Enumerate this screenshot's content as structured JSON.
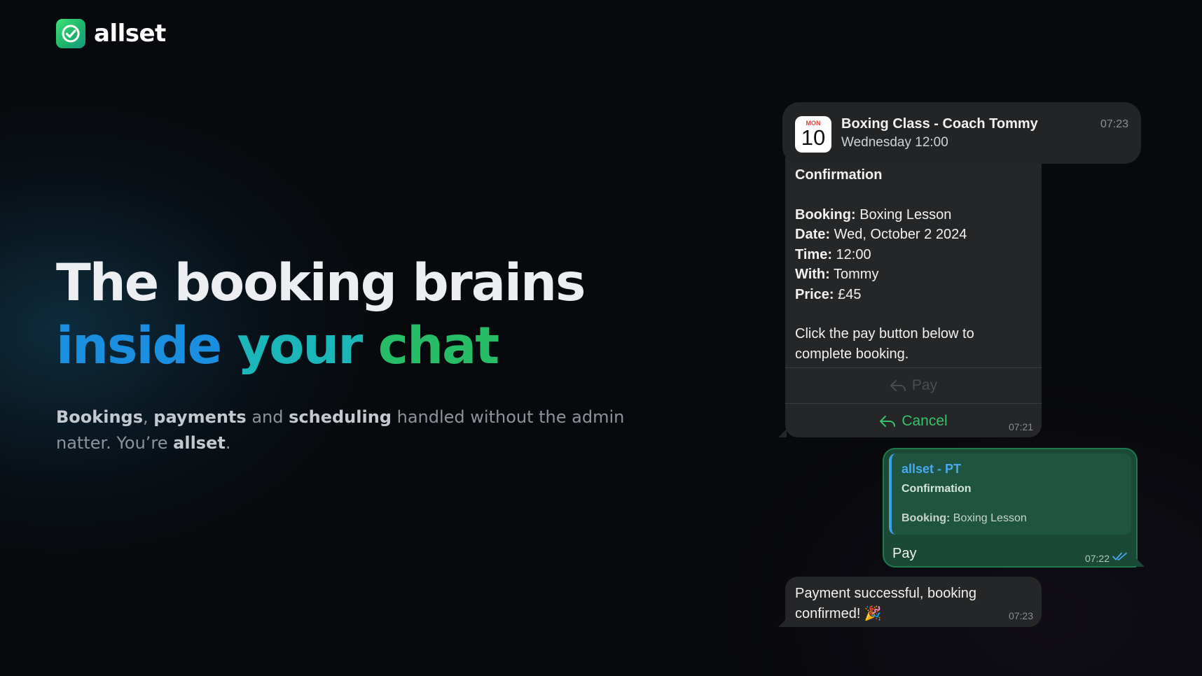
{
  "brand": {
    "name": "allset",
    "logo_icon": "check-badge-icon",
    "logo_gradient": [
      "#3ee27a",
      "#169a86"
    ]
  },
  "hero": {
    "line1": "The booking brains",
    "line2": {
      "w1": "inside",
      "w2": "your",
      "w3": "chat"
    },
    "colors": {
      "inside": "#1a8fe0",
      "your": "#1ab6b8",
      "chat": "#27bd67"
    }
  },
  "subtitle": {
    "b1": "Bookings",
    "t1": ", ",
    "b2": "payments",
    "t2": " and ",
    "b3": "scheduling",
    "t3": " handled without the admin natter. You’re ",
    "b4": "allset",
    "t4": "."
  },
  "event": {
    "cal_month": "MON",
    "cal_day": "10",
    "title": "Boxing Class - Coach Tommy",
    "subtitle": "Wednesday 12:00",
    "time": "07:23"
  },
  "confirmation": {
    "heading": "Confirmation",
    "rows": [
      {
        "label": "Booking:",
        "value": "Boxing Lesson"
      },
      {
        "label": "Date:",
        "value": "Wed, October 2 2024"
      },
      {
        "label": "Time:",
        "value": "12:00"
      },
      {
        "label": "With:",
        "value": "Tommy"
      },
      {
        "label": "Price:",
        "value": "£45"
      }
    ],
    "instruction": "Click the pay button below to complete booking.",
    "pay_label": "Pay",
    "cancel_label": "Cancel",
    "time": "07:21"
  },
  "reply": {
    "quote_name": "allset - PT",
    "quote_title": "Confirmation",
    "quote_label": "Booking:",
    "quote_value": "Boxing Lesson",
    "text": "Pay",
    "time": "07:22"
  },
  "success": {
    "text": "Payment successful, booking confirmed! 🎉",
    "time": "07:23"
  }
}
